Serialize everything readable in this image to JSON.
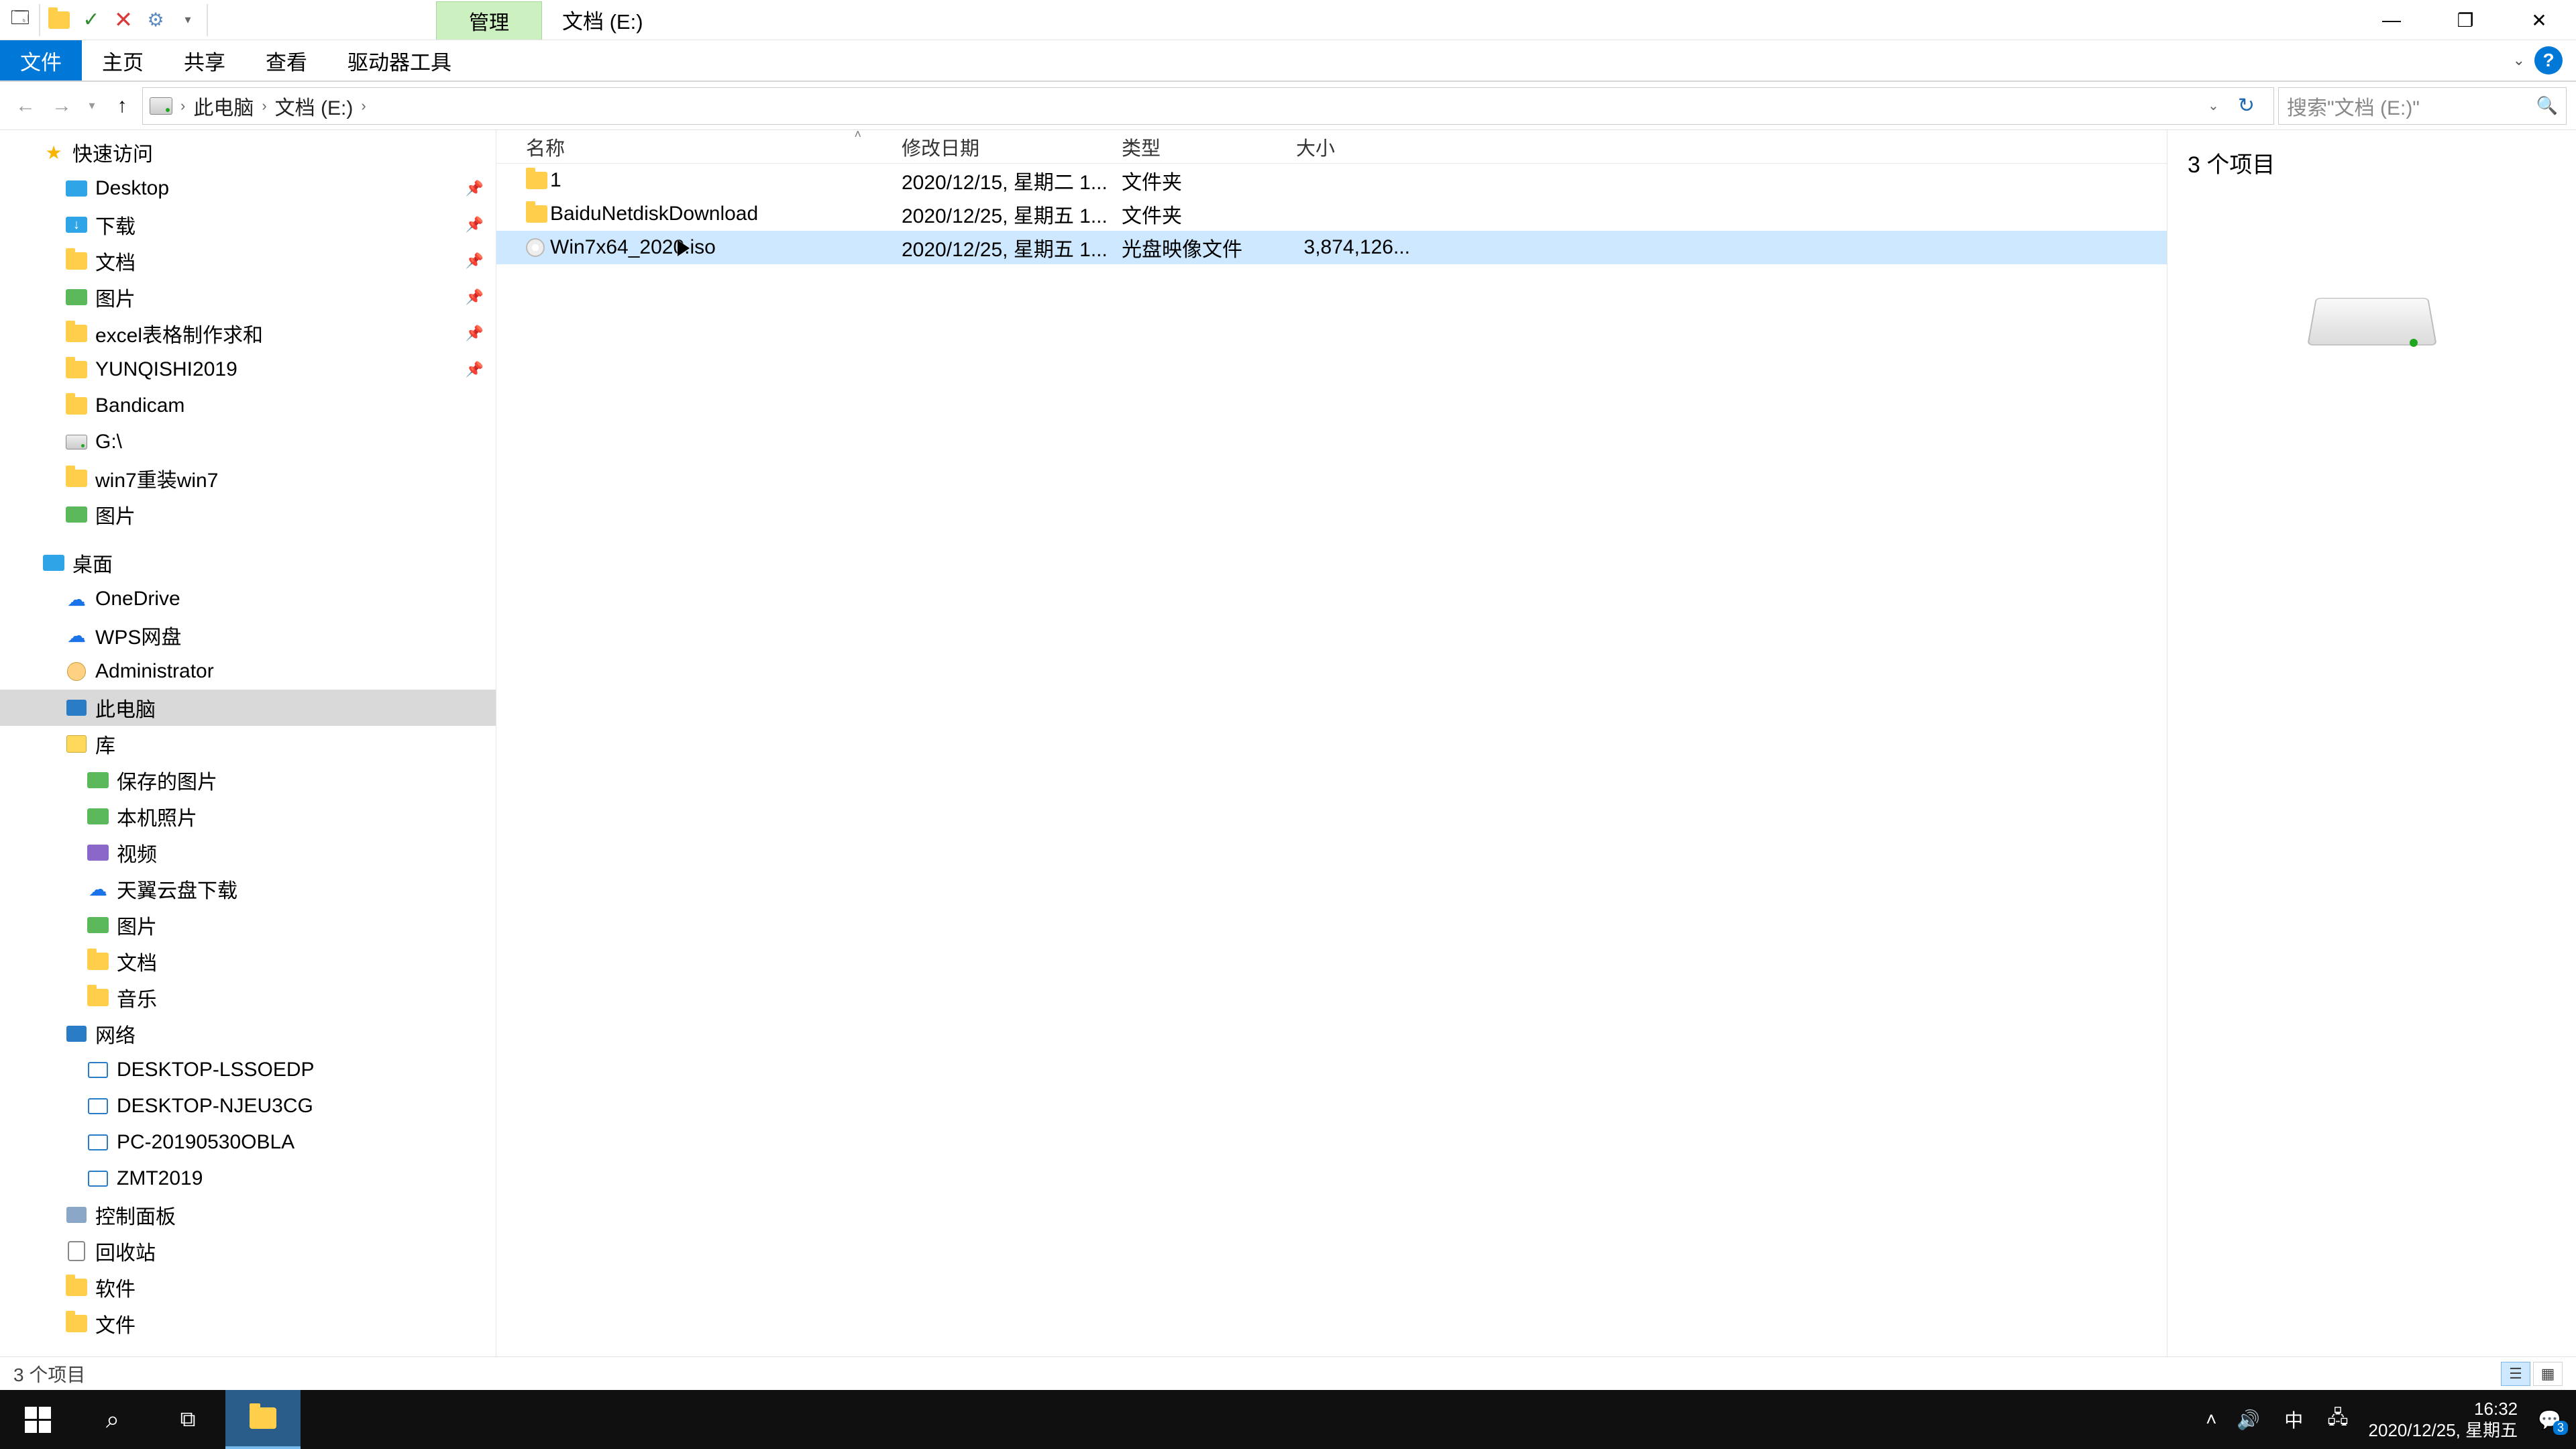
{
  "title_bar": {
    "context_tab": "管理",
    "window_title": "文档 (E:)"
  },
  "ribbon": {
    "file": "文件",
    "home": "主页",
    "share": "共享",
    "view": "查看",
    "drive_tools": "驱动器工具"
  },
  "breadcrumb": {
    "this_pc": "此电脑",
    "drive": "文档 (E:)"
  },
  "search": {
    "placeholder": "搜索\"文档 (E:)\""
  },
  "nav": {
    "quick_access": "快速访问",
    "desktop": "Desktop",
    "downloads": "下载",
    "documents": "文档",
    "pictures": "图片",
    "excel_templates": "excel表格制作求和",
    "yunqishi": "YUNQISHI2019",
    "bandicam": "Bandicam",
    "g_drive": "G:\\",
    "win7_reinstall": "win7重装win7",
    "pictures2": "图片",
    "desktop_zh": "桌面",
    "onedrive": "OneDrive",
    "wps": "WPS网盘",
    "administrator": "Administrator",
    "this_pc": "此电脑",
    "libraries": "库",
    "saved_pictures": "保存的图片",
    "camera_roll": "本机照片",
    "videos": "视频",
    "tianyiyun": "天翼云盘下载",
    "pictures3": "图片",
    "documents2": "文档",
    "music": "音乐",
    "network": "网络",
    "net1": "DESKTOP-LSSOEDP",
    "net2": "DESKTOP-NJEU3CG",
    "net3": "PC-20190530OBLA",
    "net4": "ZMT2019",
    "control_panel": "控制面板",
    "recycle_bin": "回收站",
    "software": "软件",
    "files": "文件"
  },
  "columns": {
    "name": "名称",
    "modified": "修改日期",
    "type": "类型",
    "size": "大小"
  },
  "rows": [
    {
      "name": "1",
      "date": "2020/12/15, 星期二 1...",
      "type": "文件夹",
      "size": "",
      "kind": "folder",
      "selected": false
    },
    {
      "name": "BaiduNetdiskDownload",
      "date": "2020/12/25, 星期五 1...",
      "type": "文件夹",
      "size": "",
      "kind": "folder",
      "selected": false
    },
    {
      "name": "Win7x64_2020.iso",
      "date": "2020/12/25, 星期五 1...",
      "type": "光盘映像文件",
      "size": "3,874,126...",
      "kind": "iso",
      "selected": true
    }
  ],
  "preview": {
    "count_label": "3 个项目"
  },
  "status": {
    "text": "3 个项目"
  },
  "taskbar": {
    "ime": "中",
    "time": "16:32",
    "date": "2020/12/25, 星期五",
    "notif_count": "3"
  }
}
